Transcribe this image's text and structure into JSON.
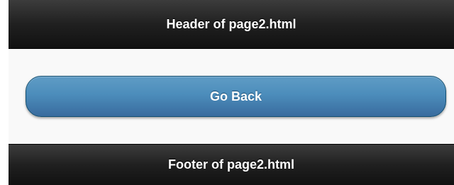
{
  "header": {
    "title": "Header of page2.html"
  },
  "content": {
    "back_button_label": "Go Back"
  },
  "footer": {
    "title": "Footer of page2.html"
  },
  "colors": {
    "bar_background": "#1e1e1e",
    "bar_text": "#ffffff",
    "content_background": "#f9f9f9",
    "button_top": "#5f9cc5",
    "button_bottom": "#396b9e",
    "button_border": "#145072"
  }
}
